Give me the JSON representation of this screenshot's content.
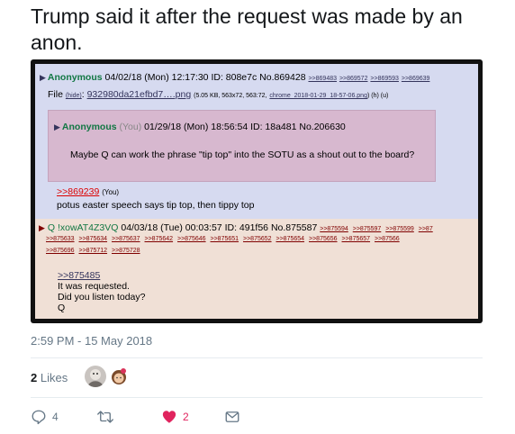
{
  "tweet": {
    "text": "Trump said it after the request was made by an anon.",
    "timestamp": "2:59 PM - 15 May 2018",
    "likes_count": "2",
    "likes_label": "Likes",
    "replies_count": "4",
    "hearts_count": "2"
  },
  "post1": {
    "name": "Anonymous",
    "date": "04/02/18 (Mon) 12:17:30",
    "id_label": "ID: 808e7c",
    "no": "No.869428",
    "backlinks": [
      ">>869483",
      ">>869572",
      ">>869593",
      ">>869639"
    ],
    "file_label": "File",
    "file_hide": "(hide)",
    "file_name": "932980da21efbd7….png",
    "file_meta": "(5.05 KB, 563x72, 563:72,",
    "file_orig": "chrome_2018-01-29_18-57-06.png",
    "file_tail": ") (h) (u)",
    "reply_link": ">>869239",
    "reply_you": "(You)",
    "body": "potus easter speech says tip top, then tippy top"
  },
  "inline_quote": {
    "name": "Anonymous",
    "you": "(You)",
    "date": "01/29/18 (Mon) 18:56:54",
    "id_label": "ID: 18a481",
    "no": "No.206630",
    "body": "Maybe Q can work the phrase \"tip top\" into the SOTU as a shout out to the board?"
  },
  "post2": {
    "name": "Q",
    "trip": "!xowAT4Z3VQ",
    "date": "04/03/18 (Tue) 00:03:57",
    "id_label": "ID: 491f56",
    "no": "No.875587",
    "backlinks_row1": [
      ">>875594",
      ">>875597",
      ">>875599",
      ">>87"
    ],
    "backlinks_row2": [
      ">>875633",
      ">>875634",
      ">>875637",
      ">>875642",
      ">>875646",
      ">>875651",
      ">>875652",
      ">>875654",
      ">>875656",
      ">>875657",
      ">>87566"
    ],
    "backlinks_row3": [
      ">>875696",
      ">>875712",
      ">>875728"
    ],
    "quote_link": ">>875485",
    "lines": [
      "It was requested.",
      "Did you listen today?",
      "Q"
    ]
  }
}
